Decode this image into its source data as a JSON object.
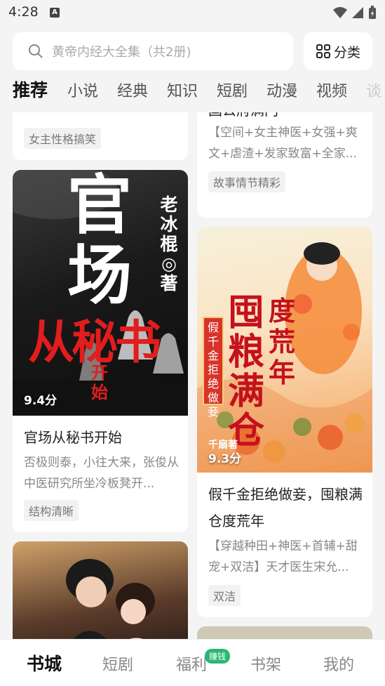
{
  "status": {
    "time": "4:28",
    "notification_glyph": "A"
  },
  "search": {
    "placeholder": "黄帝内经大全集（共2册)"
  },
  "category_button": {
    "label": "分类"
  },
  "tabs": [
    "推荐",
    "小说",
    "经典",
    "知识",
    "短剧",
    "动漫",
    "视频",
    "谈"
  ],
  "cards": {
    "top_left": {
      "tag": "女主性格搞笑"
    },
    "top_right": {
      "title_fragment": "国公府满门",
      "desc": "【空间+女主神医+女强+爽文+虐渣+发家致富+全家...",
      "tag": "故事情节精彩"
    },
    "book1": {
      "cover_title": "官场从秘书开始",
      "cover_author": "老冰棍◎著",
      "cover_subtitle": "开始",
      "score": "9.4分",
      "title": "官场从秘书开始",
      "desc": "否极则泰，小往大来，张俊从中医研究所坐冷板凳开...",
      "tag": "结构清晰"
    },
    "book2": {
      "cover_title_a": "囤粮满仓",
      "cover_title_b": "度荒年",
      "cover_subtitle": "假千金拒绝做妾",
      "cover_author": "千扇著",
      "score": "9.3分",
      "title": "假千金拒绝做妾，囤粮满仓度荒年",
      "desc": "【穿越种田+神医+首辅+甜宠+双洁】天才医生宋允...",
      "tag": "双洁"
    }
  },
  "bottom_nav": {
    "items": [
      "书城",
      "短剧",
      "福利",
      "书架",
      "我的"
    ],
    "badge": "赚钱"
  },
  "colors": {
    "accent_green": "#2bb673",
    "background": "#f4f4f4"
  }
}
